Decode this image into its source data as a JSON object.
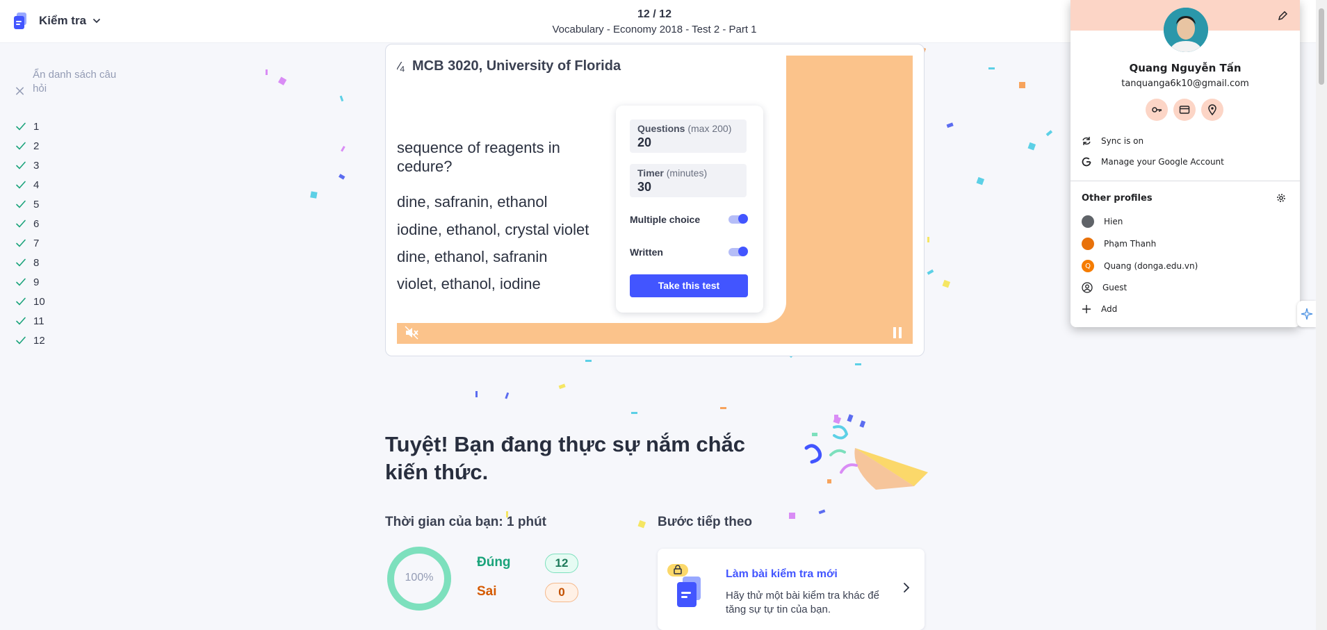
{
  "topbar": {
    "mode_label": "Kiểm tra",
    "progress": "12 / 12",
    "set_title": "Vocabulary - Economy 2018 - Test 2 - Part 1"
  },
  "sidebar": {
    "hide_label": "Ẩn danh sách câu hỏi",
    "questions": [
      "1",
      "2",
      "3",
      "4",
      "5",
      "6",
      "7",
      "8",
      "9",
      "10",
      "11",
      "12"
    ]
  },
  "video": {
    "slide_header": "MCB 3020, University of Florida",
    "question_lines": [
      "sequence of reagents in",
      "cedure?",
      "dine, safranin, ethanol",
      "iodine, ethanol, crystal violet",
      "dine, ethanol, safranin",
      "violet, ethanol, iodine"
    ],
    "questions_label": "Questions",
    "questions_hint": "(max 200)",
    "questions_value": "20",
    "timer_label": "Timer",
    "timer_hint": "(minutes)",
    "timer_value": "30",
    "multiple_choice_label": "Multiple choice",
    "written_label": "Written",
    "take_test_label": "Take this test"
  },
  "result": {
    "headline": "Tuyệt! Bạn đang thực sự nắm chắc kiến thức.",
    "time_label": "Thời gian của bạn: 1 phút",
    "next_label": "Bước tiếp theo",
    "percent": "100%",
    "percent_value": 1.0,
    "correct_label": "Đúng",
    "correct_count": "12",
    "wrong_label": "Sai",
    "wrong_count": "0",
    "next_card": {
      "title": "Làm bài kiểm tra mới",
      "description": "Hãy thử một bài kiểm tra khác để tăng sự tự tin của bạn."
    }
  },
  "profile": {
    "name": "Quang Nguyễn Tấn",
    "email": "tanquanga6k10@gmail.com",
    "sync": "Sync is on",
    "manage": "Manage your Google Account",
    "other_profiles_label": "Other profiles",
    "others": [
      {
        "name": "Hien",
        "color": "#5f6368",
        "initial": ""
      },
      {
        "name": "Phạm Thanh",
        "color": "#e8710a",
        "initial": ""
      },
      {
        "name": "Quang (donga.edu.vn)",
        "color": "#f57c00",
        "initial": "Q"
      }
    ],
    "guest": "Guest",
    "add": "Add"
  },
  "colors": {
    "accent": "#4255ff",
    "correct": "#1aa37a",
    "wrong": "#d55a00",
    "ring": "#7de0bd",
    "video_bg": "#fbc38b",
    "profile_header": "#fcd5c6"
  }
}
